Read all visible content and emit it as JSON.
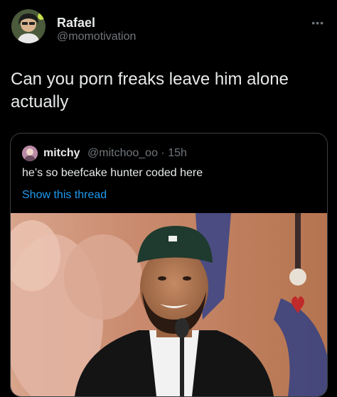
{
  "tweet": {
    "author_name": "Rafael",
    "author_handle": "@momotivation",
    "more_icon": "more-horizontal-icon",
    "text": "Can you porn freaks leave him alone actually"
  },
  "quoted": {
    "author_name": "mitchy",
    "author_handle": "@mitchoo_oo",
    "separator": "·",
    "time": "15h",
    "text": "he’s so beefcake hunter coded here",
    "show_thread": "Show this thread"
  },
  "colors": {
    "background": "#000000",
    "text": "#e7e9ea",
    "secondary": "#71767b",
    "link": "#1d9bf0",
    "border": "#3a3f44"
  }
}
